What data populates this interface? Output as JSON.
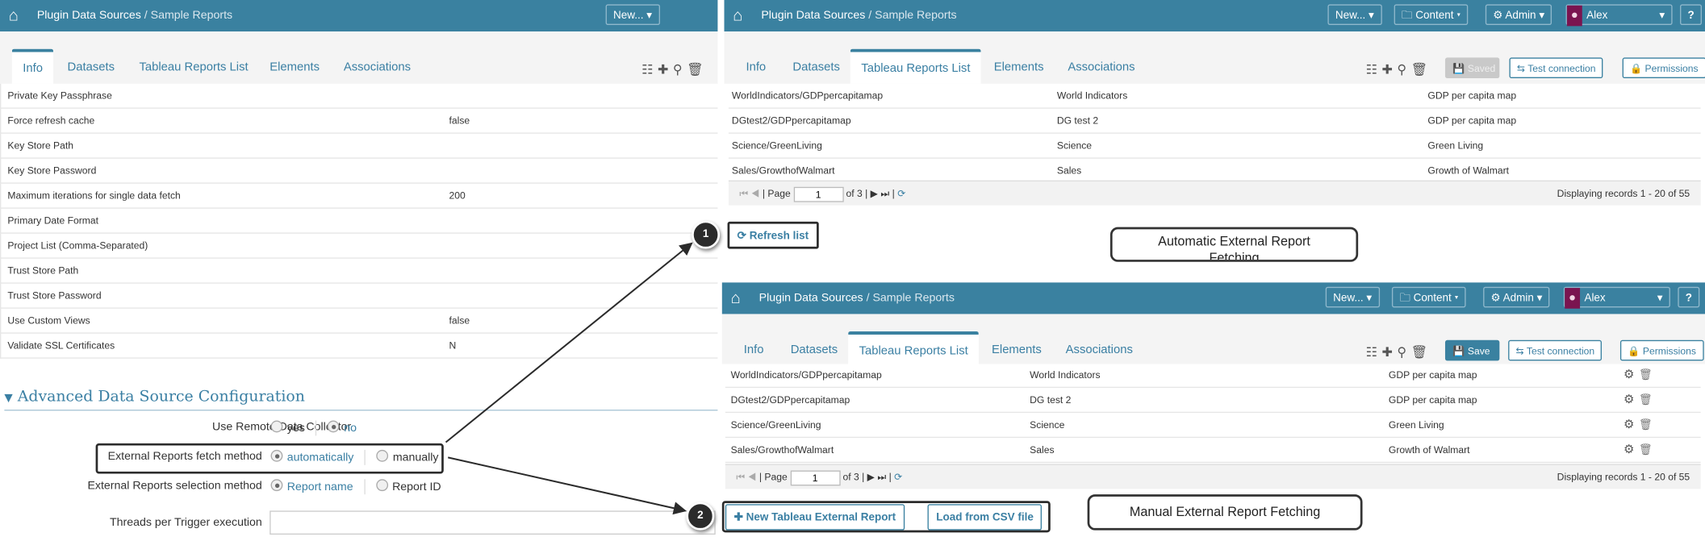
{
  "colors": {
    "header": "#3a81a0",
    "accent": "#3a7fa3",
    "avatar": "#7a1450"
  },
  "breadcrumb": {
    "root": "Plugin Data Sources",
    "separator": " / ",
    "current": "Sample Reports"
  },
  "header": {
    "new_label": "New...",
    "content_label": "Content",
    "admin_label": "Admin",
    "user_name": "Alex",
    "help_label": "?"
  },
  "tabs": [
    "Info",
    "Datasets",
    "Tableau Reports List",
    "Elements",
    "Associations"
  ],
  "toolbar": {
    "saved_label": "Saved",
    "save_label": "Save",
    "test_connection_label": "Test connection",
    "permissions_label": "Permissions"
  },
  "info_table": [
    {
      "name": "Private Key Passphrase",
      "value": ""
    },
    {
      "name": "Force refresh cache",
      "value": "false"
    },
    {
      "name": "Key Store Path",
      "value": ""
    },
    {
      "name": "Key Store Password",
      "value": ""
    },
    {
      "name": "Maximum iterations for single data fetch",
      "value": "200"
    },
    {
      "name": "Primary Date Format",
      "value": ""
    },
    {
      "name": "Project List (Comma-Separated)",
      "value": ""
    },
    {
      "name": "Trust Store Path",
      "value": ""
    },
    {
      "name": "Trust Store Password",
      "value": ""
    },
    {
      "name": "Use Custom Views",
      "value": "false"
    },
    {
      "name": "Validate SSL Certificates",
      "value": "N"
    }
  ],
  "advanced": {
    "title": "Advanced Data Source Configuration",
    "remote_collector": {
      "label": "Use Remote Data Collector",
      "options": [
        "yes",
        "no"
      ],
      "selected": "no"
    },
    "fetch_method": {
      "label": "External Reports fetch method",
      "options": [
        "automatically",
        "manually"
      ],
      "selected": "automatically"
    },
    "selection_method": {
      "label": "External Reports selection method",
      "options": [
        "Report name",
        "Report ID"
      ],
      "selected": "Report name"
    },
    "threads": {
      "label": "Threads per Trigger execution",
      "value": ""
    }
  },
  "reports": [
    {
      "path": "WorldIndicators/GDPpercapitamap",
      "project": "World Indicators",
      "name": "GDP per capita map"
    },
    {
      "path": "DGtest2/GDPpercapitamap",
      "project": "DG test 2",
      "name": "GDP per capita map"
    },
    {
      "path": "Science/GreenLiving",
      "project": "Science",
      "name": "Green Living"
    },
    {
      "path": "Sales/GrowthofWalmart",
      "project": "Sales",
      "name": "Growth of Walmart"
    }
  ],
  "pager": {
    "page_label": "Page",
    "page": "1",
    "of_label": "of 3",
    "display": "Displaying records 1 - 20 of 55"
  },
  "actions": {
    "refresh_list": "Refresh list",
    "new_report": "New Tableau External Report",
    "load_csv": "Load from CSV file"
  },
  "callouts": {
    "automatic": "Automatic External Report Fetching",
    "manual": "Manual External Report Fetching"
  },
  "markers": [
    "1",
    "2"
  ]
}
